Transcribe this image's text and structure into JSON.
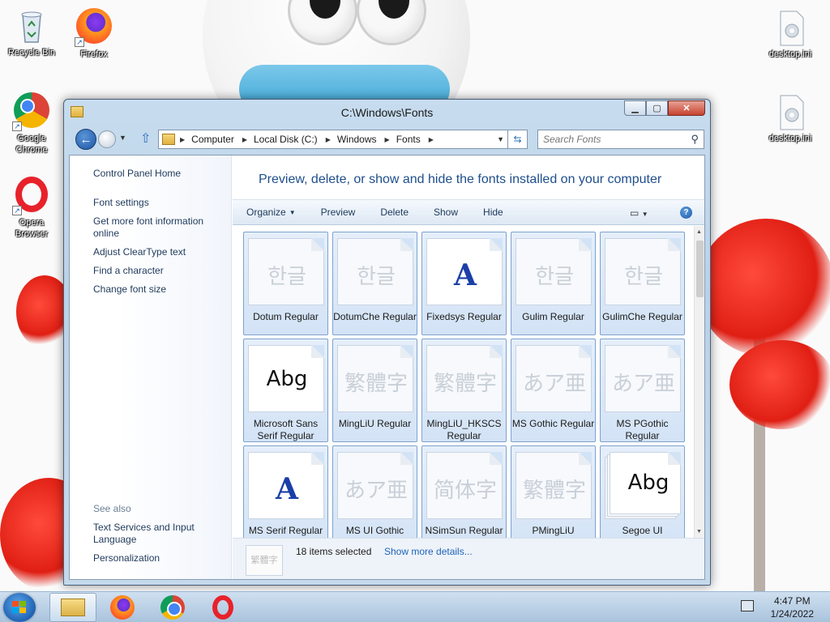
{
  "desktop": {
    "icons": [
      {
        "label": "Recycle Bin",
        "icon": "recycle-bin-icon"
      },
      {
        "label": "Firefox",
        "icon": "firefox-icon"
      },
      {
        "label": "Google Chrome",
        "icon": "chrome-icon"
      },
      {
        "label": "Opera Browser",
        "icon": "opera-icon"
      },
      {
        "label": "desktop.ini",
        "icon": "ini-file-icon"
      },
      {
        "label": "desktop.ini",
        "icon": "ini-file-icon"
      }
    ]
  },
  "window": {
    "title": "C:\\Windows\\Fonts",
    "breadcrumbs": [
      "Computer",
      "Local Disk (C:)",
      "Windows",
      "Fonts"
    ],
    "search_placeholder": "Search Fonts",
    "header_text": "Preview, delete, or show and hide the fonts installed on your computer",
    "left_pane": {
      "links": [
        "Control Panel Home",
        "Font settings",
        "Get more font information online",
        "Adjust ClearType text",
        "Find a character",
        "Change font size"
      ],
      "see_also_title": "See also",
      "see_also_links": [
        "Text Services and Input Language",
        "Personalization"
      ]
    },
    "toolbar": {
      "organize": "Organize",
      "preview": "Preview",
      "delete": "Delete",
      "show": "Show",
      "hide": "Hide"
    },
    "fonts": [
      {
        "name": "Dotum Regular",
        "sample": "한글",
        "style": "faint"
      },
      {
        "name": "DotumChe Regular",
        "sample": "한글",
        "style": "faint"
      },
      {
        "name": "Fixedsys Regular",
        "sample": "A",
        "style": "bigA"
      },
      {
        "name": "Gulim Regular",
        "sample": "한글",
        "style": "faint"
      },
      {
        "name": "GulimChe Regular",
        "sample": "한글",
        "style": "faint"
      },
      {
        "name": "Microsoft Sans Serif Regular",
        "sample": "Abg",
        "style": "dark"
      },
      {
        "name": "MingLiU Regular",
        "sample": "繁體字",
        "style": "faint"
      },
      {
        "name": "MingLiU_HKSCS Regular",
        "sample": "繁體字",
        "style": "faint"
      },
      {
        "name": "MS Gothic Regular",
        "sample": "あア亜",
        "style": "faint"
      },
      {
        "name": "MS PGothic Regular",
        "sample": "あア亜",
        "style": "faint"
      },
      {
        "name": "MS Serif Regular",
        "sample": "A",
        "style": "bigA"
      },
      {
        "name": "MS UI Gothic",
        "sample": "あア亜",
        "style": "faint"
      },
      {
        "name": "NSimSun Regular",
        "sample": "简体字",
        "style": "faint"
      },
      {
        "name": "PMingLiU",
        "sample": "繁體字",
        "style": "faint"
      },
      {
        "name": "Segoe UI",
        "sample": "Abg",
        "style": "stack"
      }
    ],
    "details": {
      "sample": "繁體字",
      "count_text": "18 items selected",
      "more_link": "Show more details..."
    }
  },
  "taskbar": {
    "time": "4:47 PM",
    "date": "1/24/2022"
  },
  "colors": {
    "accent": "#1e4e8c",
    "tile_selected": "#d3e3f6",
    "link": "#1e64b8"
  }
}
